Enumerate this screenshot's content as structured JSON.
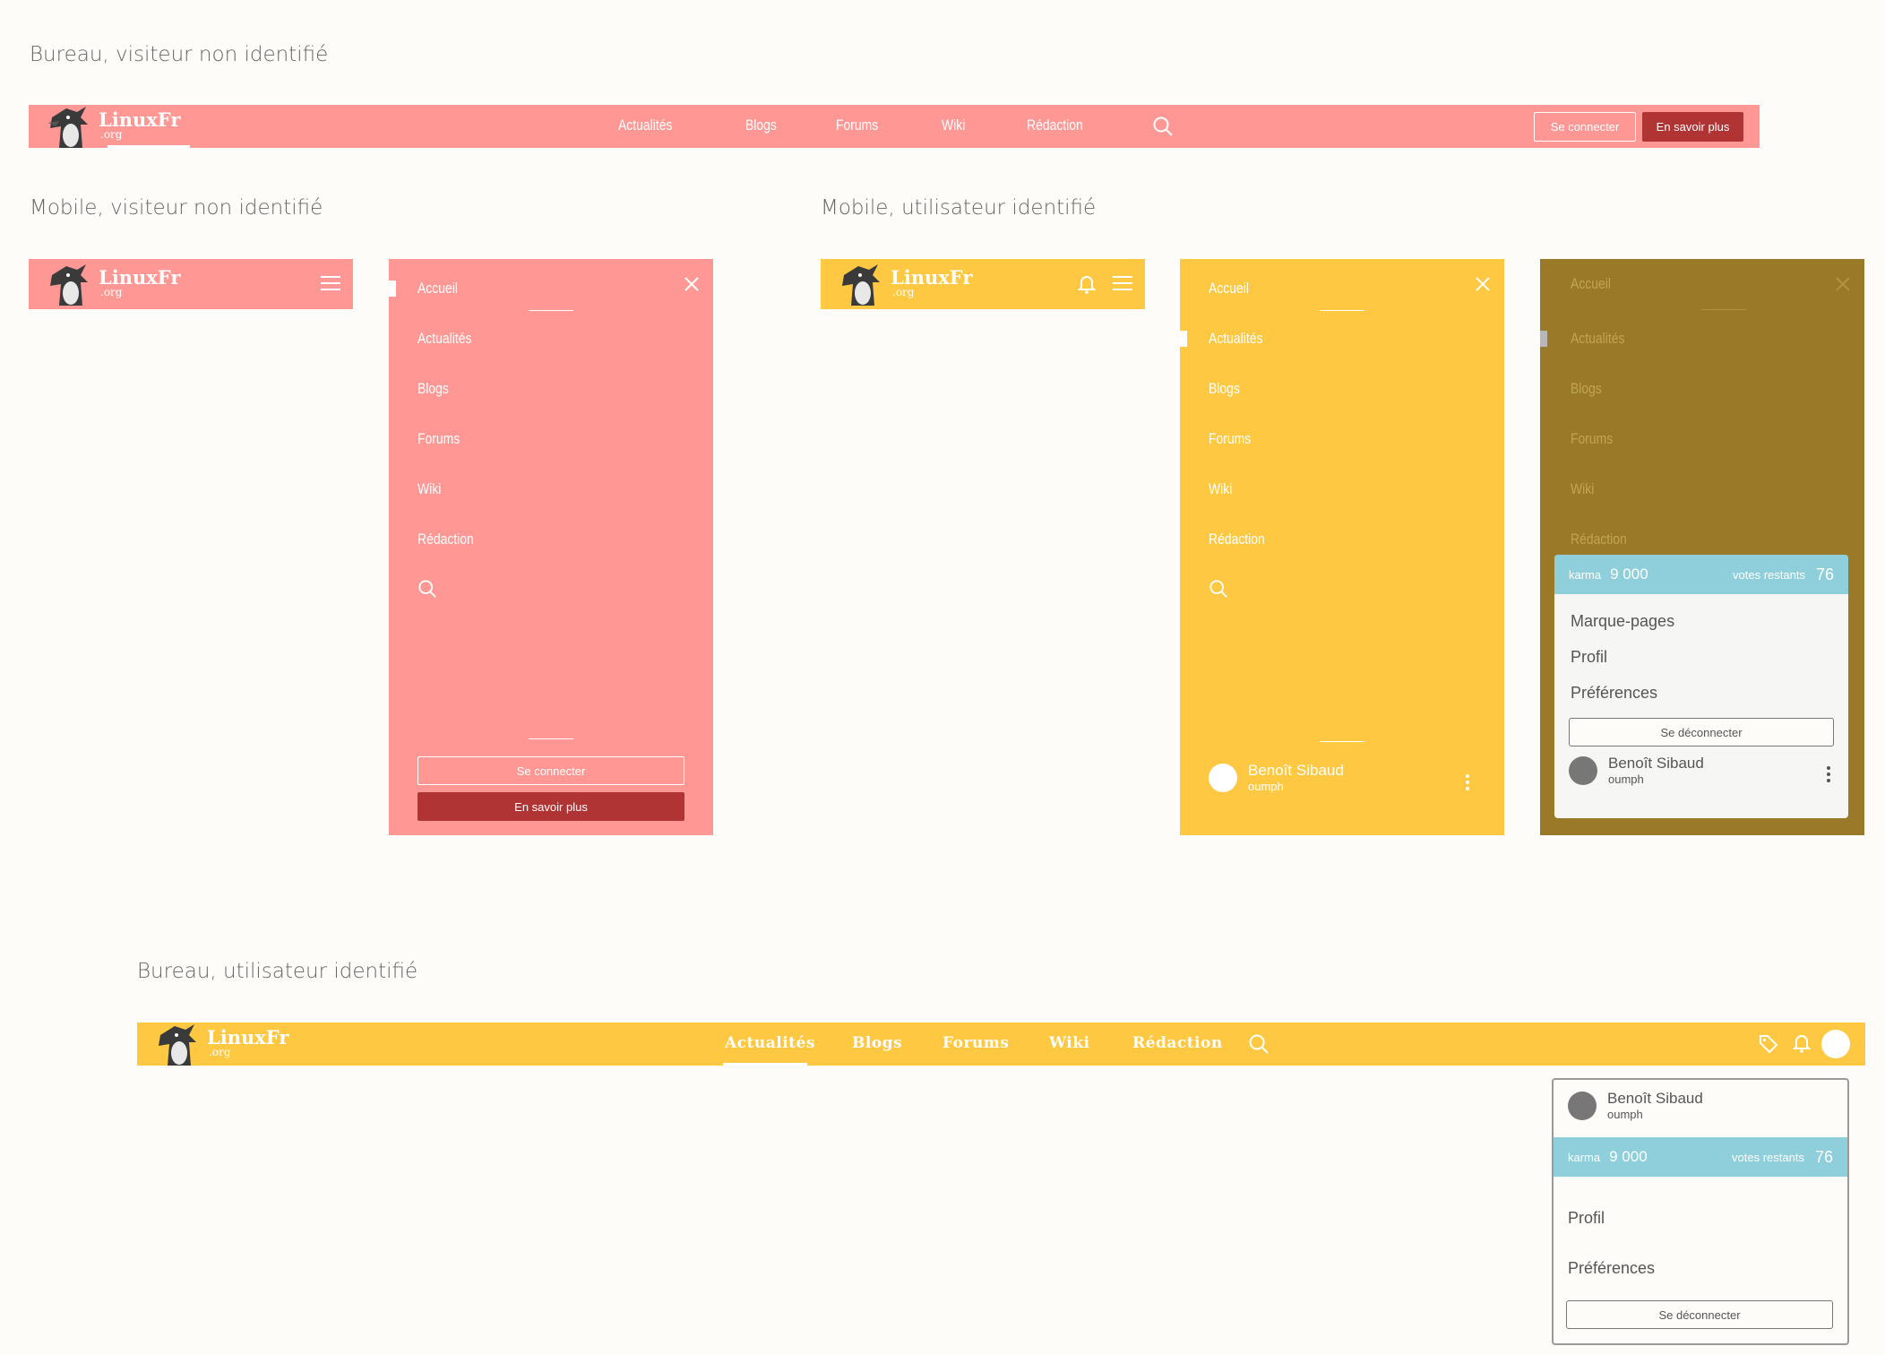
{
  "sections": {
    "desktop_guest": "Bureau, visiteur non identifié",
    "mobile_guest": "Mobile, visiteur non identifié",
    "mobile_user": "Mobile, utilisateur identifié",
    "desktop_user": "Bureau, utilisateur identifié"
  },
  "logo": {
    "name": "LinuxFr",
    "tld": ".org"
  },
  "nav": {
    "home": "Accueil",
    "items": [
      "Actualités",
      "Blogs",
      "Forums",
      "Wiki",
      "Rédaction"
    ]
  },
  "buttons": {
    "login": "Se connecter",
    "learn_more": "En savoir plus",
    "logout": "Se déconnecter"
  },
  "user": {
    "name": "Benoît Sibaud",
    "handle": "oumph"
  },
  "stats": {
    "karma_label": "karma",
    "karma_value": "9 000",
    "votes_label": "votes restants",
    "votes_value": "76"
  },
  "user_menu": {
    "bookmarks": "Marque-pages",
    "profile": "Profil",
    "preferences": "Préférences"
  },
  "colors": {
    "guest": "#ff9895",
    "user": "#fec842",
    "user_dimmed": "#9a7928",
    "accent_dark": "#b03434",
    "karma_bar": "#8ecfdb"
  },
  "icons": [
    "penguin-logo-icon",
    "search-icon",
    "hamburger-icon",
    "close-icon",
    "bell-icon",
    "tag-icon",
    "kebab-icon"
  ]
}
